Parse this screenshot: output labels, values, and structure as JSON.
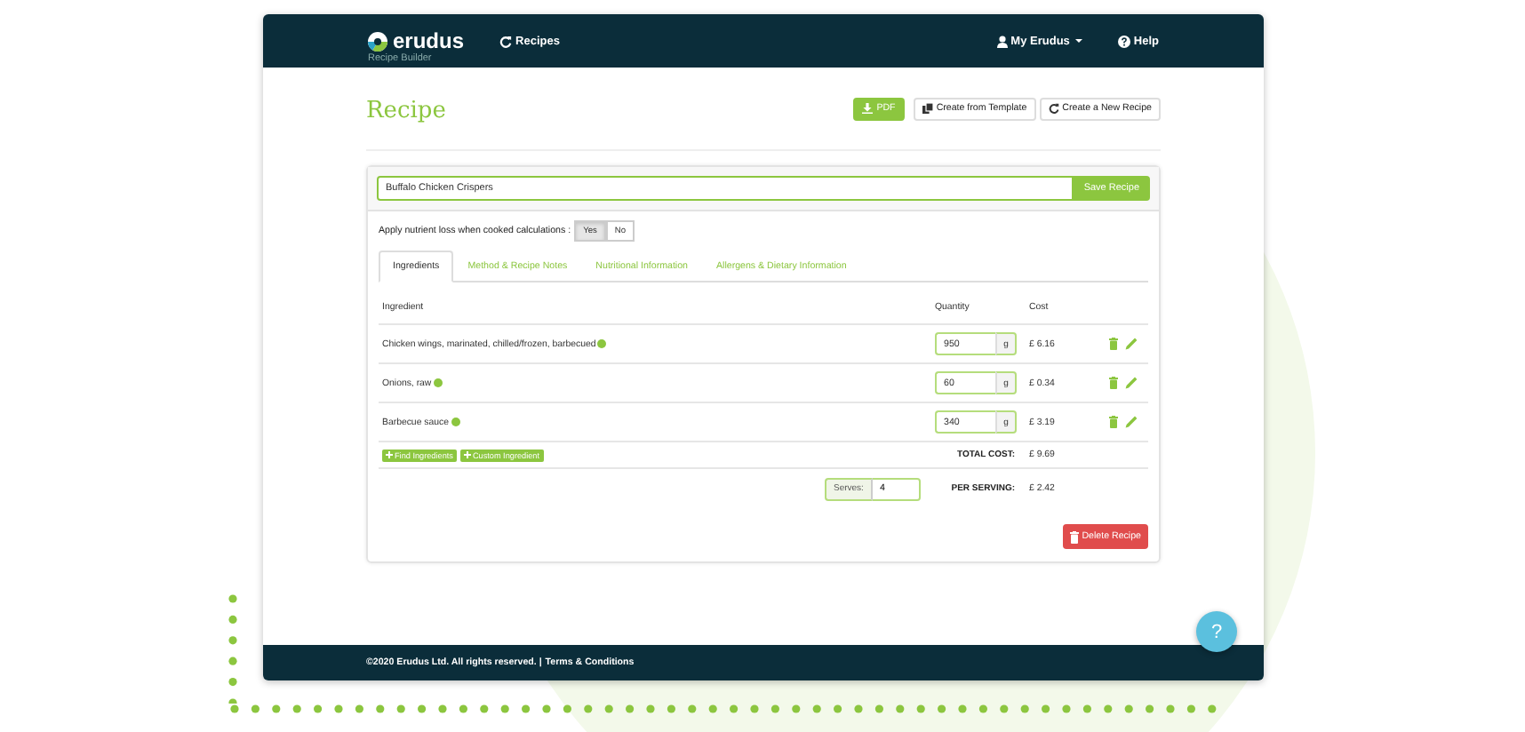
{
  "header": {
    "logo": "erudus",
    "subtitle": "Recipe Builder",
    "nav": [
      {
        "label": "Recipes"
      }
    ],
    "user_menu": "My Erudus",
    "help": "Help"
  },
  "page_title": "Recipe",
  "actions": [
    {
      "kind": "download",
      "label": "PDF"
    },
    {
      "kind": "template",
      "label": "Create from Template"
    },
    {
      "kind": "new",
      "label": "Create a New Recipe"
    }
  ],
  "recipe_name": {
    "value": "Buffalo Chicken Crispers",
    "button": "Save Recipe"
  },
  "nutrient_loss": {
    "label": "Apply nutrient loss when cooked calculations :",
    "options": [
      {
        "label": "Yes",
        "selected": true
      },
      {
        "label": "No",
        "selected": false
      }
    ]
  },
  "tabs": [
    {
      "label": "Ingredients",
      "selected": true
    },
    {
      "label": "Method & Recipe Notes",
      "selected": false
    },
    {
      "label": "Nutritional Information",
      "selected": false
    },
    {
      "label": "Allergens & Dietary Information",
      "selected": false
    }
  ],
  "table": {
    "columns": [
      "Ingredient",
      "Quantity",
      "Cost"
    ],
    "rows": [
      {
        "ingredient": "Chicken wings, marinated, chilled/frozen, barbecued",
        "quantity": "950",
        "unit": "g",
        "cost": "£ 6.16"
      },
      {
        "ingredient": "Onions, raw",
        "quantity": "60",
        "unit": "g",
        "cost": "£ 0.34"
      },
      {
        "ingredient": "Barbecue sauce",
        "quantity": "340",
        "unit": "g",
        "cost": "£ 3.19"
      }
    ]
  },
  "add_buttons": [
    "Find Ingredients",
    "Custom Ingredient"
  ],
  "total": {
    "label": "TOTAL COST:",
    "value": "£ 9.69"
  },
  "serves": {
    "label": "Serves:",
    "value": "4"
  },
  "per_serving": {
    "label": "PER SERVING:",
    "value": "£ 2.42"
  },
  "delete_button": "Delete Recipe",
  "footer": {
    "text": "©2020 Erudus Ltd. All rights reserved. |",
    "link": "Terms & Conditions"
  },
  "help_bubble": "?"
}
